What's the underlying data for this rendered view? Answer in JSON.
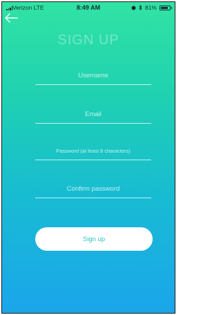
{
  "status_bar": {
    "carrier": "Verizon  LTE",
    "time": "8:49 AM",
    "battery_percent": "81%",
    "battery_level": 0.81
  },
  "nav": {
    "back_icon": "arrow-left-icon"
  },
  "form": {
    "title": "SIGN UP",
    "username_placeholder": "Username",
    "email_placeholder": "Email",
    "password_placeholder": "Password (at least 8 characters)",
    "confirm_password_placeholder": "Confirm password",
    "submit_label": "Sign up"
  },
  "colors": {
    "gradient_top": "#31e3a3",
    "gradient_bottom": "#1ba5eb",
    "button_text": "#2bc3c3"
  }
}
